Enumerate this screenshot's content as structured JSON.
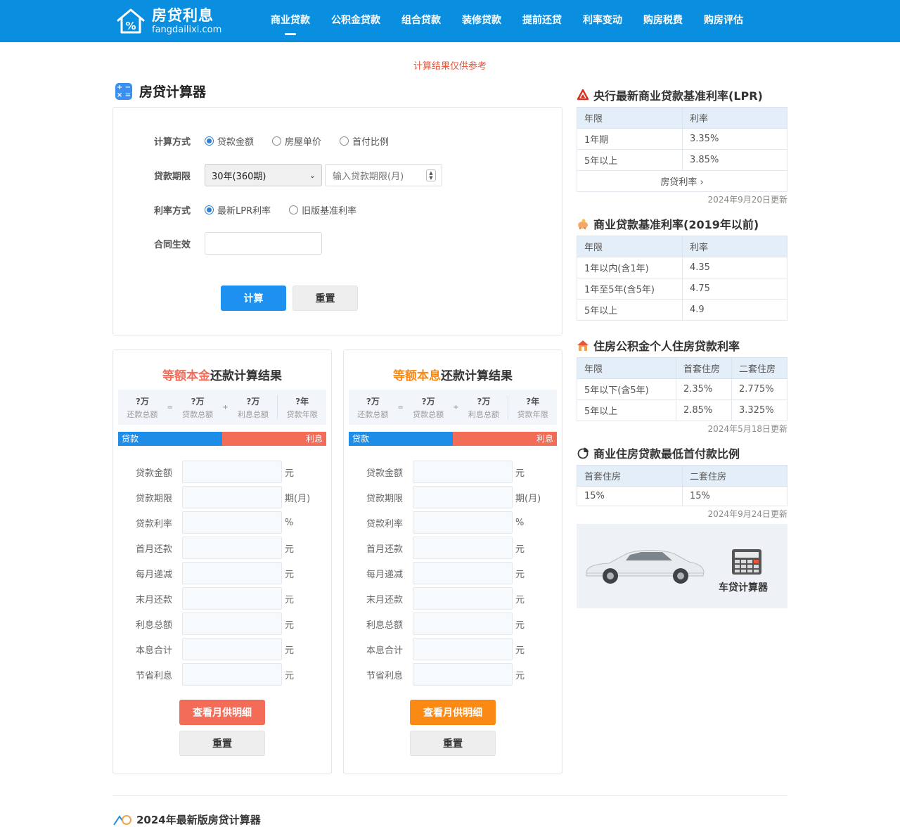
{
  "header": {
    "logo_cn": "房贷利息",
    "logo_en": "fangdailixi.com",
    "nav": [
      "商业贷款",
      "公积金贷款",
      "组合贷款",
      "装修贷款",
      "提前还贷",
      "利率变动",
      "购房税费",
      "购房评估"
    ],
    "active_nav": "商业贷款"
  },
  "notice": "计算结果仅供参考",
  "calculator": {
    "title": "房贷计算器",
    "method_label": "计算方式",
    "method_options": [
      "贷款金额",
      "房屋单价",
      "首付比例"
    ],
    "method_selected": "贷款金额",
    "term_label": "贷款期限",
    "term_selected": "30年(360期)",
    "term_input_placeholder": "输入贷款期限(月)",
    "rate_label": "利率方式",
    "rate_options": [
      "最新LPR利率",
      "旧版基准利率"
    ],
    "rate_selected": "最新LPR利率",
    "contract_label": "合同生效",
    "calc_button": "计算",
    "reset_button": "重置"
  },
  "results": [
    {
      "title_highlight": "等额本金",
      "title_rest": "还款计算结果",
      "highlight_color": "#f26c58",
      "summary": [
        {
          "value": "?万",
          "label": "还款总额"
        },
        {
          "value": "?万",
          "label": "贷款总额"
        },
        {
          "value": "?万",
          "label": "利息总额"
        },
        {
          "value": "?年",
          "label": "贷款年限"
        }
      ],
      "ops": [
        "=",
        "+"
      ],
      "bar_left": "贷款",
      "bar_right": "利息",
      "rows": [
        {
          "label": "贷款金额",
          "unit": "元"
        },
        {
          "label": "贷款期限",
          "unit": "期(月)"
        },
        {
          "label": "贷款利率",
          "unit": "%"
        },
        {
          "label": "首月还款",
          "unit": "元"
        },
        {
          "label": "每月递减",
          "unit": "元"
        },
        {
          "label": "末月还款",
          "unit": "元"
        },
        {
          "label": "利息总额",
          "unit": "元"
        },
        {
          "label": "本息合计",
          "unit": "元"
        },
        {
          "label": "节省利息",
          "unit": "元"
        }
      ],
      "detail_button": "查看月供明细",
      "detail_color": "#f26c58",
      "reset_button": "重置"
    },
    {
      "title_highlight": "等额本息",
      "title_rest": "还款计算结果",
      "highlight_color": "#fa8a14",
      "summary": [
        {
          "value": "?万",
          "label": "还款总额"
        },
        {
          "value": "?万",
          "label": "贷款总额"
        },
        {
          "value": "?万",
          "label": "利息总额"
        },
        {
          "value": "?年",
          "label": "贷款年限"
        }
      ],
      "ops": [
        "=",
        "+"
      ],
      "bar_left": "贷款",
      "bar_right": "利息",
      "rows": [
        {
          "label": "贷款金额",
          "unit": "元"
        },
        {
          "label": "贷款期限",
          "unit": "期(月)"
        },
        {
          "label": "贷款利率",
          "unit": "%"
        },
        {
          "label": "首月还款",
          "unit": "元"
        },
        {
          "label": "每月递减",
          "unit": "元"
        },
        {
          "label": "末月还款",
          "unit": "元"
        },
        {
          "label": "利息总额",
          "unit": "元"
        },
        {
          "label": "本息合计",
          "unit": "元"
        },
        {
          "label": "节省利息",
          "unit": "元"
        }
      ],
      "detail_button": "查看月供明细",
      "detail_color": "#fa8a14",
      "reset_button": "重置"
    }
  ],
  "sidebar": {
    "lpr": {
      "title": "央行最新商业贷款基准利率(LPR)",
      "headers": [
        "年限",
        "利率"
      ],
      "rows": [
        [
          "1年期",
          "3.35%"
        ],
        [
          "5年以上",
          "3.85%"
        ]
      ],
      "more_link": "房贷利率 ›",
      "updated": "2024年9月20日更新"
    },
    "base": {
      "title": "商业贷款基准利率(2019年以前)",
      "headers": [
        "年限",
        "利率"
      ],
      "rows": [
        [
          "1年以内(含1年)",
          "4.35"
        ],
        [
          "1年至5年(含5年)",
          "4.75"
        ],
        [
          "5年以上",
          "4.9"
        ]
      ]
    },
    "fund": {
      "title": "住房公积金个人住房贷款利率",
      "headers": [
        "年限",
        "首套住房",
        "二套住房"
      ],
      "rows": [
        [
          "5年以下(含5年)",
          "2.35%",
          "2.775%"
        ],
        [
          "5年以上",
          "2.85%",
          "3.325%"
        ]
      ],
      "updated": "2024年5月18日更新"
    },
    "downpay": {
      "title": "商业住房贷款最低首付款比例",
      "headers": [
        "首套住房",
        "二套住房"
      ],
      "rows": [
        [
          "15%",
          "15%"
        ]
      ],
      "updated": "2024年9月24日更新"
    },
    "car_card_label": "车贷计算器"
  },
  "footer_title": "2024年最新版房贷计算器"
}
